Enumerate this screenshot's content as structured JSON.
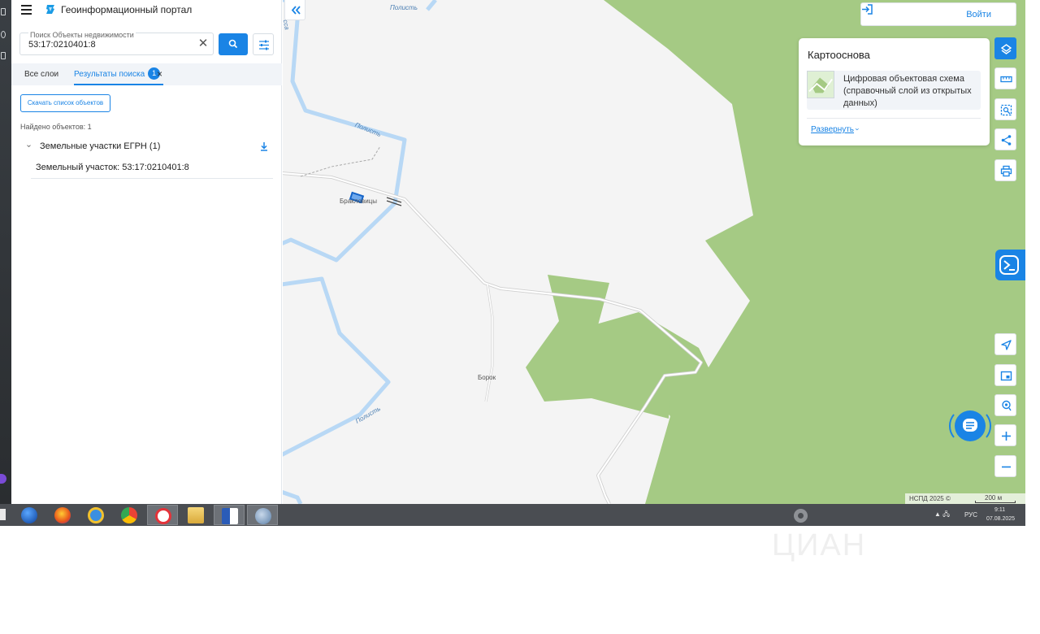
{
  "app": {
    "title": "Геоинформационный портал"
  },
  "search": {
    "label": "Поиск Объекты недвижимости",
    "value": "53:17:0210401:8",
    "clear_icon": "✕"
  },
  "tabs": [
    {
      "label": "Все слои"
    },
    {
      "label": "Результаты поиска",
      "badge": "1"
    }
  ],
  "results": {
    "download_label": "Скачать список объектов",
    "found_label": "Найдено объектов: 1",
    "group_label": "Земельные участки ЕГРН (1)",
    "item_label": "Земельный участок: 53:17:0210401:8"
  },
  "map": {
    "login_label": "Войти",
    "basemap": {
      "title": "Картооснова",
      "item_name": "Цифровая объектовая схема (справочный слой из открытых данных)",
      "expand_label": "Развернуть"
    },
    "labels": {
      "river1": "Полисть",
      "river2": "Полисть",
      "river3": "Полисть",
      "village1": "Бракловицы",
      "village2": "Борок",
      "edge_top": "сса"
    },
    "attribution": "НСПД 2025 ©",
    "scale_label": "200 м",
    "colors": {
      "forest": "#a5ca84",
      "river": "#b8d8f5",
      "background": "#f4f4f4",
      "accent": "#1a84e5"
    }
  },
  "taskbar": {
    "tray": "▲ 🖧",
    "lang": "РУС",
    "time": "9:11",
    "date": "07.08.2025"
  },
  "watermark": "ЦИАН"
}
